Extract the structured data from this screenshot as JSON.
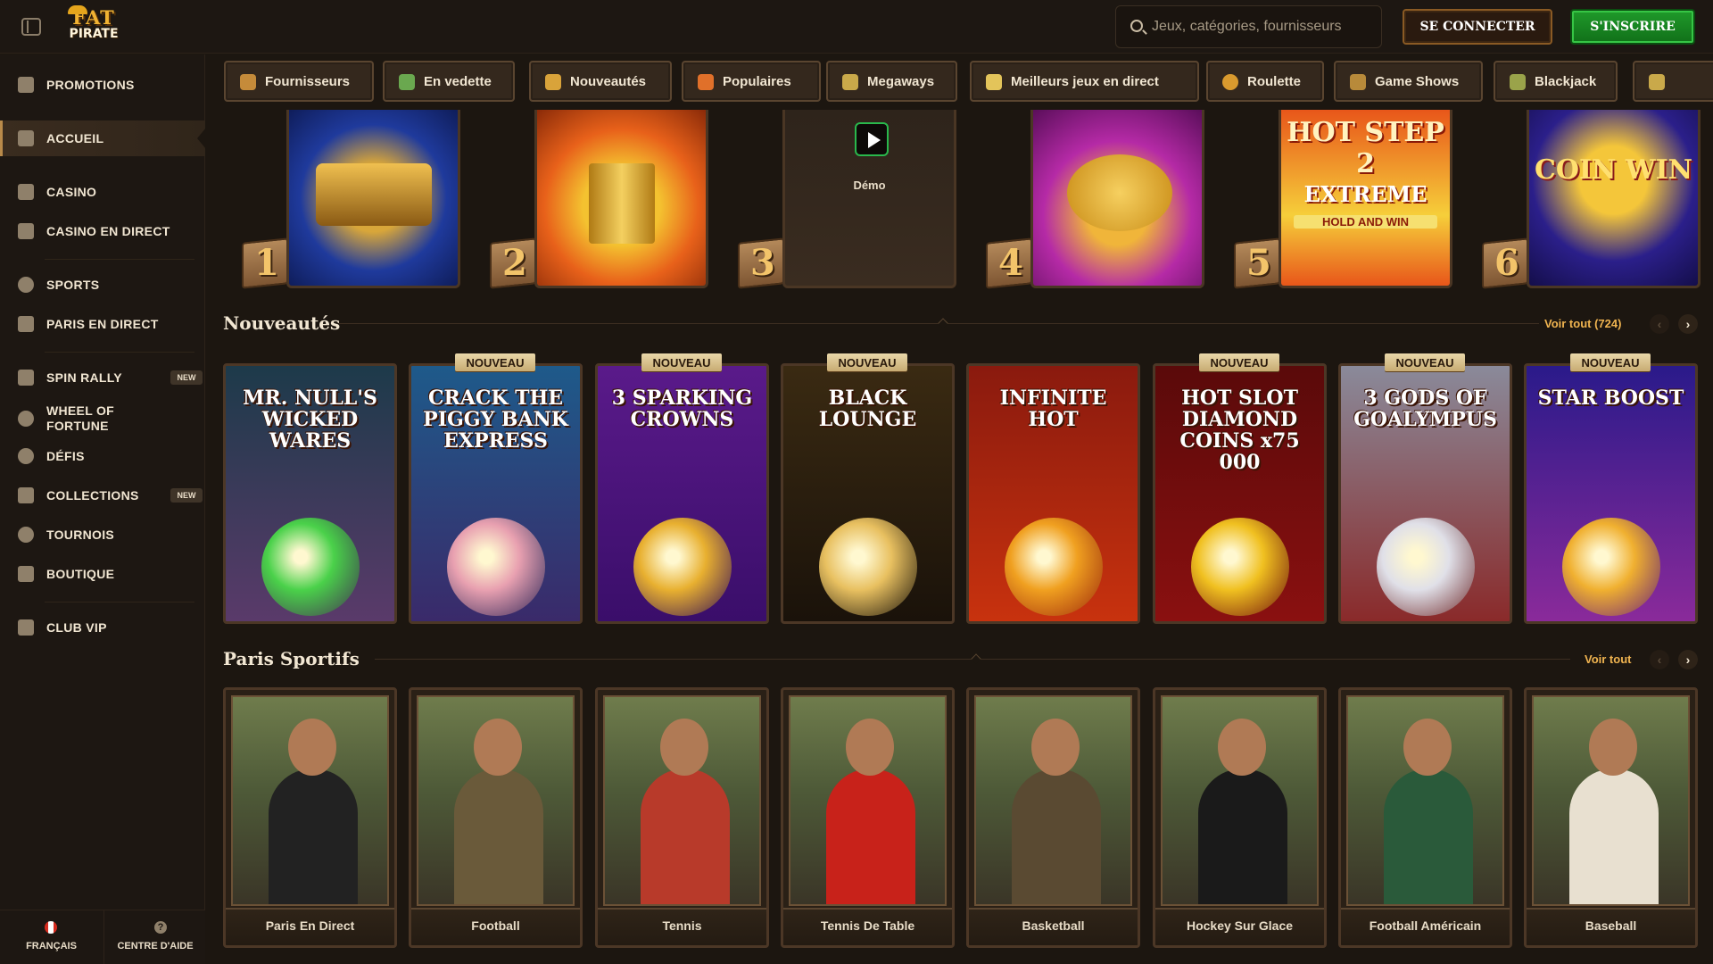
{
  "header": {
    "logo_line1": "FAT",
    "logo_line2": "PIRATE",
    "search_placeholder": "Jeux, catégories, fournisseurs",
    "login_label": "SE CONNECTER",
    "signup_label": "S'INSCRIRE"
  },
  "sidebar": {
    "items": [
      {
        "label": "PROMOTIONS",
        "icon": "gift-icon"
      },
      {
        "label": "ACCUEIL",
        "icon": "home-icon",
        "active": true
      },
      {
        "label": "CASINO",
        "icon": "slot-machine-icon"
      },
      {
        "label": "CASINO EN DIRECT",
        "icon": "live-casino-icon"
      },
      {
        "label": "SPORTS",
        "icon": "soccer-ball-icon"
      },
      {
        "label": "PARIS EN DIRECT",
        "icon": "live-icon"
      },
      {
        "label": "SPIN RALLY",
        "icon": "flag-icon",
        "badge": "NEW"
      },
      {
        "label": "WHEEL OF FORTUNE",
        "icon": "wheel-icon"
      },
      {
        "label": "DÉFIS",
        "icon": "target-icon"
      },
      {
        "label": "COLLECTIONS",
        "icon": "collection-icon",
        "badge": "NEW"
      },
      {
        "label": "TOURNOIS",
        "icon": "trophy-icon"
      },
      {
        "label": "BOUTIQUE",
        "icon": "basket-icon"
      },
      {
        "label": "CLUB VIP",
        "icon": "diamond-icon"
      }
    ],
    "footer": {
      "language": "FRANÇAIS",
      "help": "CENTRE D'AIDE",
      "help_glyph": "?"
    }
  },
  "categories": [
    {
      "label": "Fournisseurs",
      "color": "#c58b3a"
    },
    {
      "label": "En vedette",
      "color": "#6aa84f"
    },
    {
      "label": "Nouveautés",
      "color": "#d9a33a"
    },
    {
      "label": "Populaires",
      "color": "#e0702a"
    },
    {
      "label": "Megaways",
      "color": "#c9a94a"
    },
    {
      "label": "Meilleurs jeux en direct",
      "color": "#e3c45a"
    },
    {
      "label": "Roulette",
      "color": "#d99a2e"
    },
    {
      "label": "Game Shows",
      "color": "#b88a3a"
    },
    {
      "label": "Blackjack",
      "color": "#9aa34a"
    }
  ],
  "top_games": {
    "ranks": [
      "1",
      "2",
      "3",
      "4",
      "5",
      "6"
    ],
    "demo_label": "Démo",
    "cards": [
      {
        "name": "train-game",
        "colors": [
          "#1f3a9c",
          "#d8a63a"
        ]
      },
      {
        "name": "golden-book-game",
        "colors": [
          "#e8611a",
          "#f4c230"
        ]
      },
      {
        "name": "demo-game",
        "colors": [
          "#2a221a",
          "#3a2c20"
        ]
      },
      {
        "name": "piggy-game",
        "colors": [
          "#b52aa6",
          "#f0b53a"
        ]
      },
      {
        "name": "hot-step-2-extreme",
        "colors": [
          "#e8561a",
          "#f6cf3a"
        ]
      },
      {
        "name": "coin-win",
        "colors": [
          "#2b1f8a",
          "#f4c63a"
        ]
      }
    ],
    "card_text": {
      "hot_step": "HOT STEP 2",
      "hot_step_sub": "EXTREME",
      "hot_step_sub2": "HOLD AND WIN",
      "coin_win": "COIN WIN"
    }
  },
  "new_games": {
    "title": "Nouveautés",
    "see_all": "Voir tout (724)",
    "ribbon": "NOUVEAU",
    "games": [
      {
        "title": "MR. NULL'S WICKED WARES",
        "bg": [
          "#1d3a4a",
          "#5a3a6a"
        ],
        "orb": "#4ad14a",
        "ribbon": false
      },
      {
        "title": "CRACK THE PIGGY BANK EXPRESS",
        "bg": [
          "#1e5a8a",
          "#3a2a6a"
        ],
        "orb": "#e8a0b0",
        "ribbon": true
      },
      {
        "title": "3 SPARKING CROWNS",
        "bg": [
          "#5a1a8a",
          "#3a0e6a"
        ],
        "orb": "#e8b030",
        "ribbon": true
      },
      {
        "title": "BLACK LOUNGE",
        "bg": [
          "#3a2a12",
          "#1a120a"
        ],
        "orb": "#e8c060",
        "ribbon": true
      },
      {
        "title": "INFINITE HOT",
        "bg": [
          "#8a1a0e",
          "#c8320e"
        ],
        "orb": "#f0a020",
        "ribbon": false
      },
      {
        "title": "HOT SLOT DIAMOND COINS x75 000",
        "bg": [
          "#5a0a0a",
          "#8a1010"
        ],
        "orb": "#f0c020",
        "ribbon": true
      },
      {
        "title": "3 GODS OF GOALYMPUS",
        "bg": [
          "#8a8a9a",
          "#8a2a2a"
        ],
        "orb": "#e0e0e8",
        "ribbon": true
      },
      {
        "title": "STAR BOOST",
        "bg": [
          "#2a1a8a",
          "#8a2a9a"
        ],
        "orb": "#f0b030",
        "ribbon": true
      }
    ]
  },
  "sports": {
    "title": "Paris Sportifs",
    "see_all": "Voir tout",
    "items": [
      {
        "label": "Paris En Direct",
        "shirt": "#222222"
      },
      {
        "label": "Football",
        "shirt": "#6a5a3a"
      },
      {
        "label": "Tennis",
        "shirt": "#b83a2a"
      },
      {
        "label": "Tennis De Table",
        "shirt": "#c8221a"
      },
      {
        "label": "Basketball",
        "shirt": "#5a4a32"
      },
      {
        "label": "Hockey Sur Glace",
        "shirt": "#1a1a1a"
      },
      {
        "label": "Football Américain",
        "shirt": "#2a5a3a"
      },
      {
        "label": "Baseball",
        "shirt": "#e8e0d0"
      }
    ]
  },
  "arrows": {
    "prev": "‹",
    "next": "›"
  }
}
